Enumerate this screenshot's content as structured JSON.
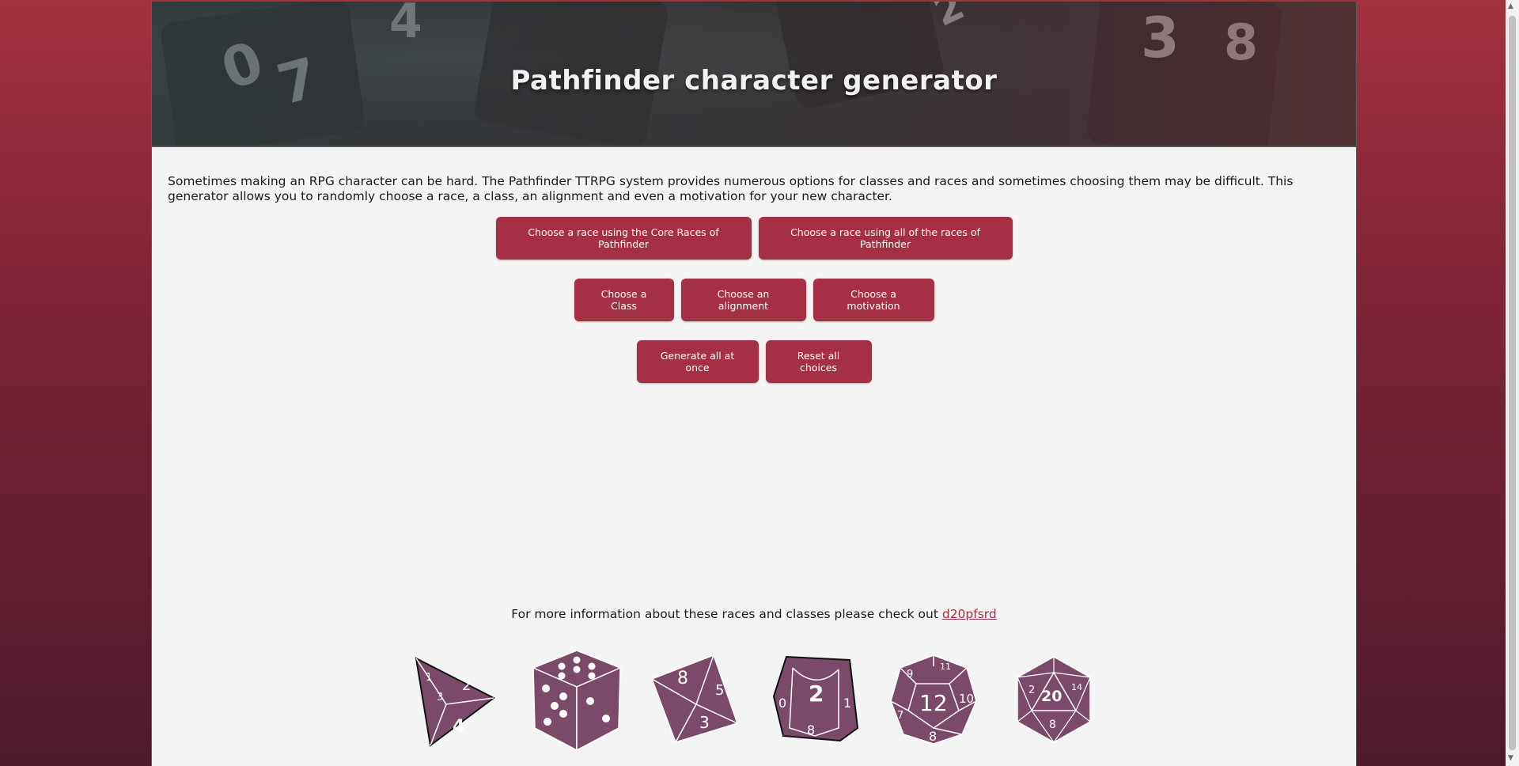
{
  "header": {
    "title": "Pathfinder character generator"
  },
  "intro": {
    "text": "Sometimes making an RPG character can be hard. The Pathfinder TTRPG system provides numerous options for classes and races and sometimes choosing them may be difficult. This generator allows you to randomly choose a race, a class, an alignment and even a motivation for your new character."
  },
  "buttons": {
    "core_races": "Choose a race using the Core Races of Pathfinder",
    "all_races": "Choose a race using all of the races of Pathfinder",
    "class": "Choose a Class",
    "alignment": "Choose an alignment",
    "motivation": "Choose a motivation",
    "generate_all": "Generate all at once",
    "reset": "Reset all choices"
  },
  "footer": {
    "more_info": "For more information about these races and classes please check out ",
    "link_text": "d20pfsrd"
  },
  "dice": {
    "d4": [
      "1",
      "2",
      "3",
      "4"
    ],
    "d8": [
      "8",
      "5",
      "3"
    ],
    "d10": [
      "2",
      "1",
      "0",
      "8"
    ],
    "d12": [
      "12",
      "9",
      "11",
      "10",
      "7",
      "8"
    ],
    "d20": [
      "20",
      "2",
      "14",
      "8"
    ]
  },
  "colors": {
    "accent": "#a52f44",
    "dice_fill": "#7b4a6b",
    "page_bg": "#f4f4f4"
  }
}
